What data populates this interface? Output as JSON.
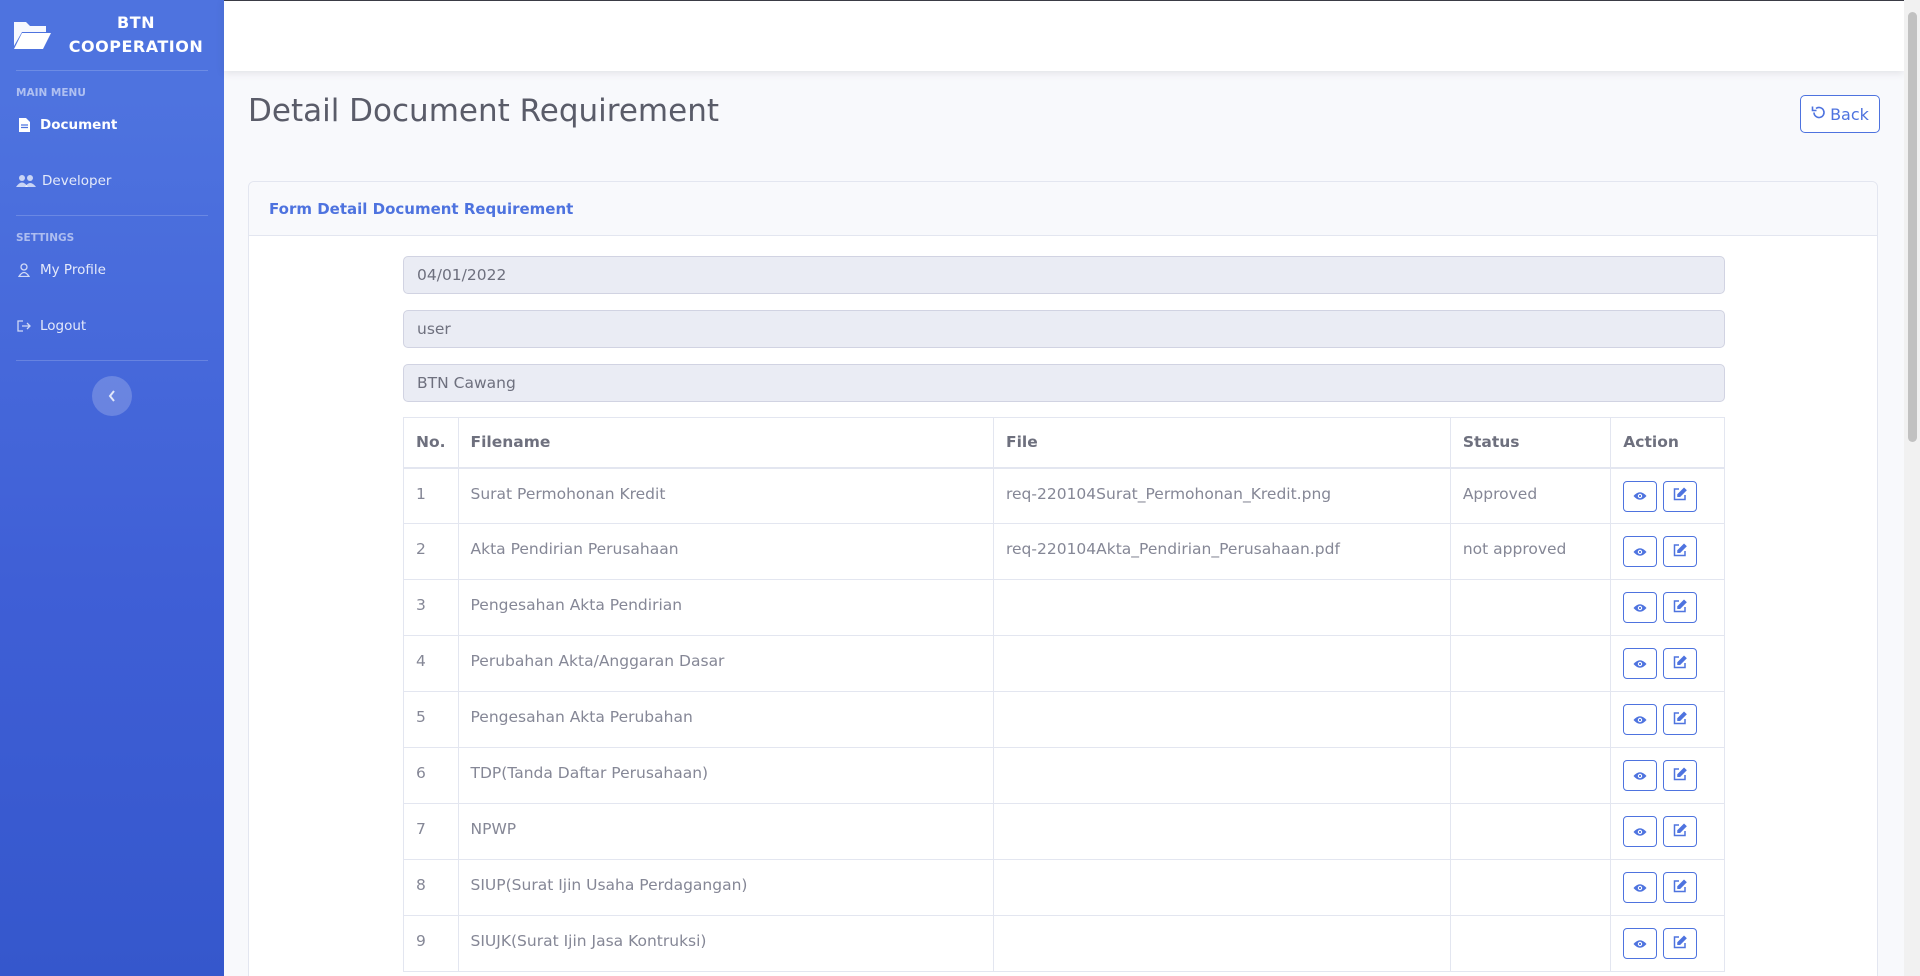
{
  "brand": {
    "line1": "BTN",
    "line2": "COOPERATION"
  },
  "sidebar": {
    "main_menu_heading": "MAIN MENU",
    "settings_heading": "SETTINGS",
    "items": [
      {
        "label": "Document",
        "icon": "file-icon"
      },
      {
        "label": "Developer",
        "icon": "users-icon"
      },
      {
        "label": "My Profile",
        "icon": "user-icon"
      },
      {
        "label": "Logout",
        "icon": "logout-icon"
      }
    ]
  },
  "page": {
    "title": "Detail Document Requirement",
    "back_label": "Back"
  },
  "card": {
    "title": "Form Detail Document Requirement"
  },
  "form": {
    "date": "04/01/2022",
    "user": "user",
    "branch": "BTN Cawang"
  },
  "table": {
    "headers": [
      "No.",
      "Filename",
      "File",
      "Status",
      "Action"
    ],
    "rows": [
      {
        "no": "1",
        "filename": "Surat Permohonan Kredit",
        "file": "req-220104Surat_Permohonan_Kredit.png",
        "status": "Approved"
      },
      {
        "no": "2",
        "filename": "Akta Pendirian Perusahaan",
        "file": "req-220104Akta_Pendirian_Perusahaan.pdf",
        "status": "not approved"
      },
      {
        "no": "3",
        "filename": "Pengesahan Akta Pendirian",
        "file": "",
        "status": ""
      },
      {
        "no": "4",
        "filename": "Perubahan Akta/Anggaran Dasar",
        "file": "",
        "status": ""
      },
      {
        "no": "5",
        "filename": "Pengesahan Akta Perubahan",
        "file": "",
        "status": ""
      },
      {
        "no": "6",
        "filename": "TDP(Tanda Daftar Perusahaan)",
        "file": "",
        "status": ""
      },
      {
        "no": "7",
        "filename": "NPWP",
        "file": "",
        "status": ""
      },
      {
        "no": "8",
        "filename": "SIUP(Surat Ijin Usaha Perdagangan)",
        "file": "",
        "status": ""
      },
      {
        "no": "9",
        "filename": "SIUJK(Surat Ijin Jasa Kontruksi)",
        "file": "",
        "status": ""
      }
    ]
  },
  "colors": {
    "primary": "#4e73df",
    "sidebar_bg": "#4e73df",
    "text": "#858796"
  }
}
